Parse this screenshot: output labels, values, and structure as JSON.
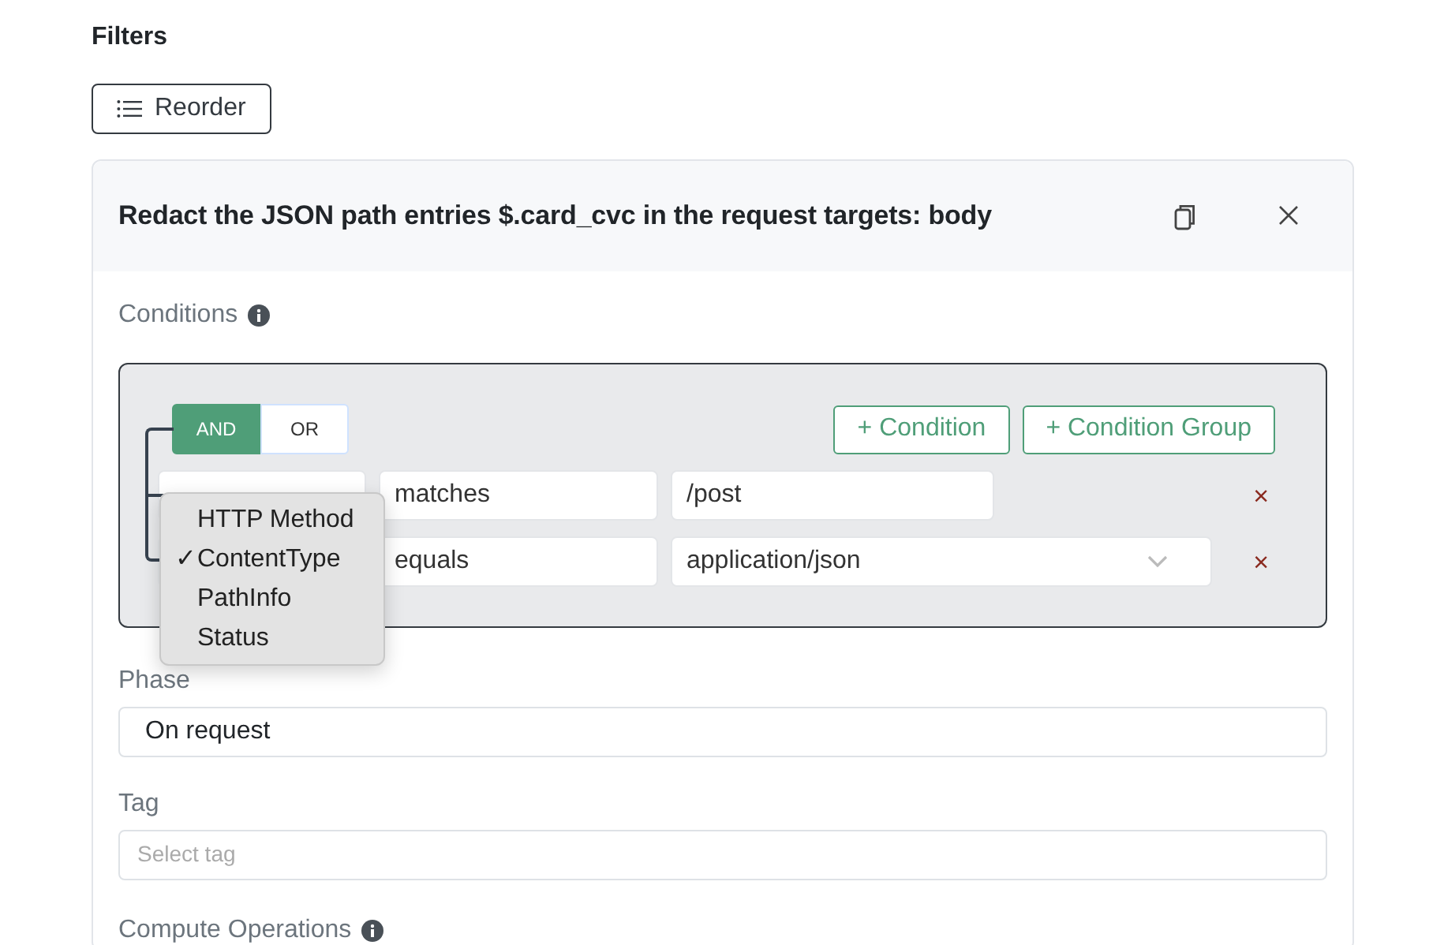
{
  "heading": "Filters",
  "reorder_button": "Reorder",
  "filter": {
    "title": "Redact the JSON path entries $.card_cvc in the request targets: body",
    "conditions_label": "Conditions",
    "operators": [
      {
        "label": "AND",
        "selected": true
      },
      {
        "label": "OR",
        "selected": false
      }
    ],
    "add_buttons": [
      "+ Condition",
      "+ Condition Group"
    ],
    "rows": [
      {
        "operator": "matches",
        "value": "/post",
        "kind": "text",
        "remove": "×"
      },
      {
        "operator": "equals",
        "value": "application/json",
        "kind": "select",
        "remove": "×"
      }
    ],
    "field_menu": [
      {
        "label": "HTTP Method",
        "checked": false
      },
      {
        "label": "ContentType",
        "checked": true
      },
      {
        "label": "PathInfo",
        "checked": false
      },
      {
        "label": "Status",
        "checked": false
      }
    ],
    "check_mark": "✓",
    "phase_label": "Phase",
    "phase_value": "On request",
    "tag_label": "Tag",
    "tag_placeholder": "Select tag",
    "compute_label": "Compute Operations"
  }
}
